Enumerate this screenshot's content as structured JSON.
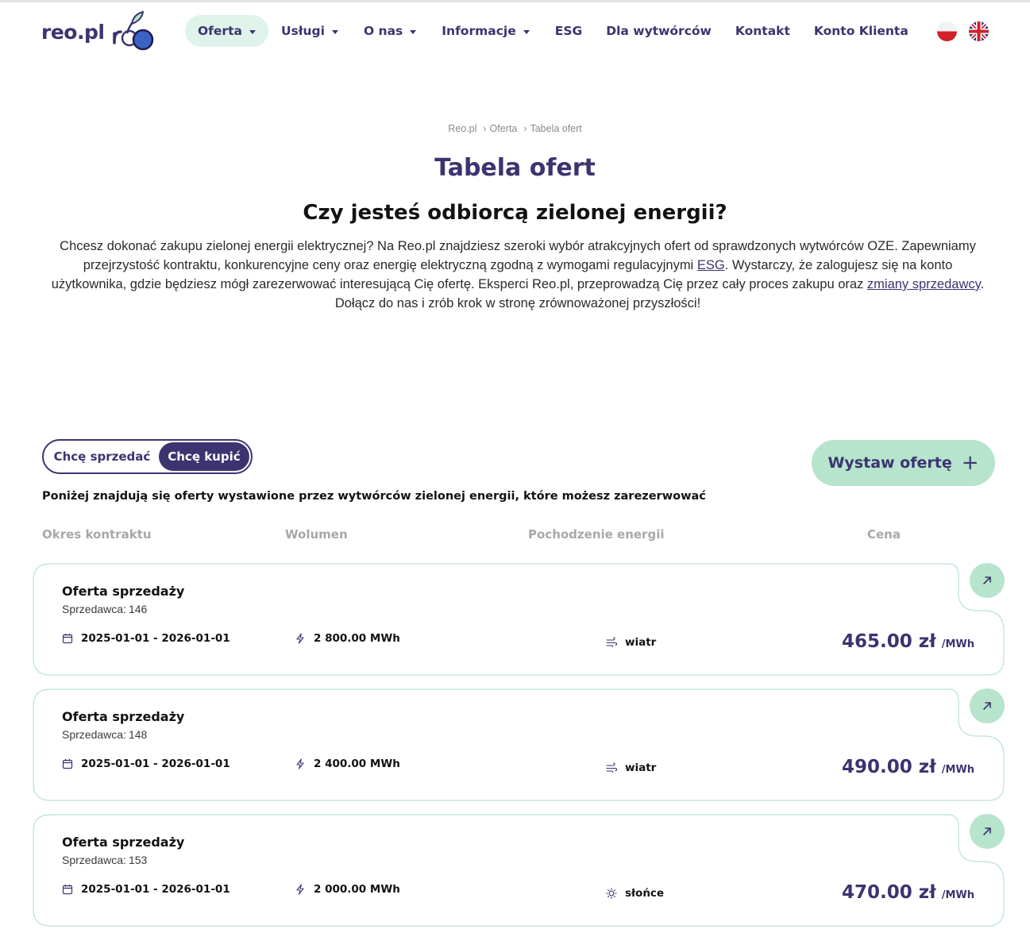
{
  "brand": {
    "name": "reo.pl"
  },
  "nav": {
    "items": [
      {
        "label": "Oferta",
        "dropdown": true,
        "active": true
      },
      {
        "label": "Usługi",
        "dropdown": true
      },
      {
        "label": "O nas",
        "dropdown": true
      },
      {
        "label": "Informacje",
        "dropdown": true
      },
      {
        "label": "ESG",
        "dropdown": false
      },
      {
        "label": "Dla wytwórców",
        "dropdown": false
      },
      {
        "label": "Kontakt",
        "dropdown": false
      },
      {
        "label": "Konto Klienta",
        "dropdown": false
      }
    ],
    "languages": [
      "pl-flag-icon",
      "uk-flag-icon"
    ]
  },
  "breadcrumb": [
    "Reo.pl",
    "Oferta",
    "Tabela ofert"
  ],
  "page": {
    "title": "Tabela ofert",
    "subtitle": "Czy jesteś odbiorcą zielonej energii?",
    "intro_1": "Chcesz dokonać zakupu zielonej energii elektrycznej? Na Reo.pl znajdziesz szeroki wybór atrakcyjnych ofert od sprawdzonych wytwórców OZE. Zapewniamy przejrzystość kontraktu, konkurencyjne ceny oraz energię elektryczną zgodną z wymogami regulacyjnymi ",
    "intro_link_1": "ESG",
    "intro_2": ". Wystarczy, że zalogujesz się na konto użytkownika, gdzie będziesz mógł zarezerwować interesującą Cię ofertę. Eksperci Reo.pl, przeprowadzą Cię przez cały proces zakupu oraz ",
    "intro_link_2": "zmiany sprzedawcy",
    "intro_3": ". Dołącz do nas i zrób krok w stronę zrównoważonej przyszłości!"
  },
  "toggle": {
    "sell": "Chcę sprzedać",
    "buy": "Chcę kupić",
    "selected": "buy"
  },
  "cta": {
    "label": "Wystaw ofertę",
    "icon": "plus-icon"
  },
  "list": {
    "caption": "Poniżej znajdują się oferty wystawione przez wytwórców zielonej energii, które możesz zarezerwować",
    "columns": [
      "Okres kontraktu",
      "Wolumen",
      "Pochodzenie energii",
      "Cena"
    ]
  },
  "offers": [
    {
      "title": "Oferta sprzedaży",
      "seller_label": "Sprzedawca:",
      "seller": "146",
      "period": "2025-01-01 - 2026-01-01",
      "volume": "2 800.00 MWh",
      "source": "wiatr",
      "source_icon": "wind-icon",
      "price": "465.00 zł",
      "unit": "/MWh"
    },
    {
      "title": "Oferta sprzedaży",
      "seller_label": "Sprzedawca:",
      "seller": "148",
      "period": "2025-01-01 - 2026-01-01",
      "volume": "2 400.00 MWh",
      "source": "wiatr",
      "source_icon": "wind-icon",
      "price": "490.00 zł",
      "unit": "/MWh"
    },
    {
      "title": "Oferta sprzedaży",
      "seller_label": "Sprzedawca:",
      "seller": "153",
      "period": "2025-01-01 - 2026-01-01",
      "volume": "2 000.00 MWh",
      "source": "słońce",
      "source_icon": "sun-icon",
      "price": "470.00 zł",
      "unit": "/MWh"
    }
  ],
  "colors": {
    "brand": "#3b3470",
    "accent_green": "#b6e4cc",
    "nav_active": "#dff3ea",
    "card_border": "#b9e3d0"
  }
}
